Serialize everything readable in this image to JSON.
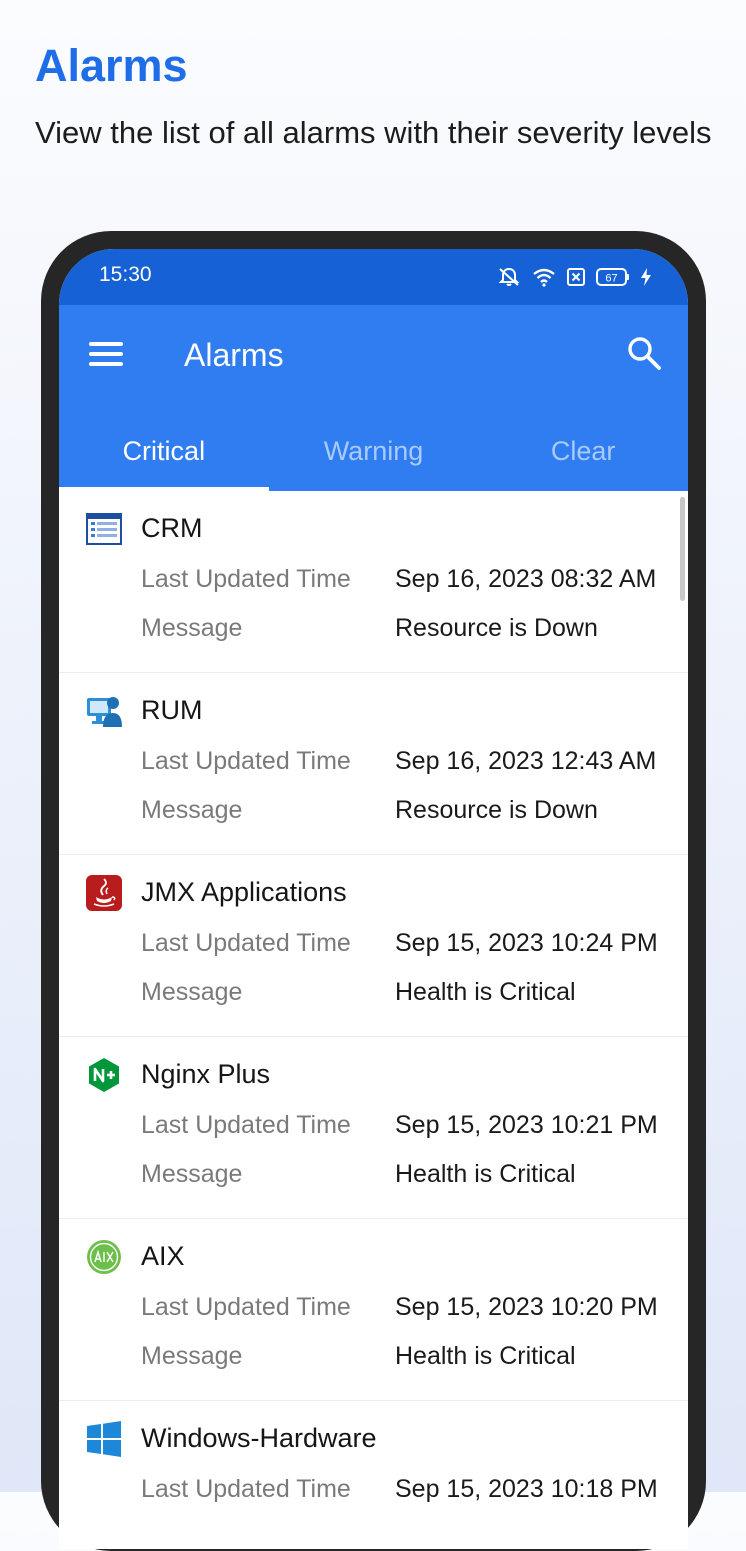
{
  "promo": {
    "title": "Alarms",
    "subtitle": "View the list of all alarms with their severity levels"
  },
  "status_bar": {
    "time": "15:30",
    "battery": "67",
    "icons": [
      "mute-icon",
      "wifi-icon",
      "sim-icon",
      "battery-icon",
      "charging-icon"
    ]
  },
  "app_bar": {
    "title": "Alarms",
    "menu_icon": "hamburger-menu-icon",
    "search_icon": "search-icon"
  },
  "tabs": [
    {
      "label": "Critical",
      "active": true
    },
    {
      "label": "Warning",
      "active": false
    },
    {
      "label": "Clear",
      "active": false
    }
  ],
  "labels": {
    "last_updated": "Last Updated Time",
    "message": "Message"
  },
  "alarms": [
    {
      "name": "CRM",
      "icon": "crm-icon",
      "time": "Sep 16, 2023 08:32 AM",
      "message": "Resource is Down"
    },
    {
      "name": "RUM",
      "icon": "rum-icon",
      "time": "Sep 16, 2023 12:43 AM",
      "message": "Resource is Down"
    },
    {
      "name": "JMX Applications",
      "icon": "java-icon",
      "time": "Sep 15, 2023 10:24 PM",
      "message": "Health is Critical"
    },
    {
      "name": "Nginx Plus",
      "icon": "nginx-plus-icon",
      "time": "Sep 15, 2023 10:21 PM",
      "message": "Health is Critical"
    },
    {
      "name": "AIX",
      "icon": "aix-icon",
      "time": "Sep 15, 2023 10:20 PM",
      "message": "Health is Critical"
    },
    {
      "name": "Windows-Hardware",
      "icon": "windows-icon",
      "time": "Sep 15, 2023 10:18 PM",
      "message": ""
    }
  ],
  "colors": {
    "accent": "#1f6ee8",
    "app_bar": "#2f7df0",
    "status_bar": "#1561d5"
  }
}
